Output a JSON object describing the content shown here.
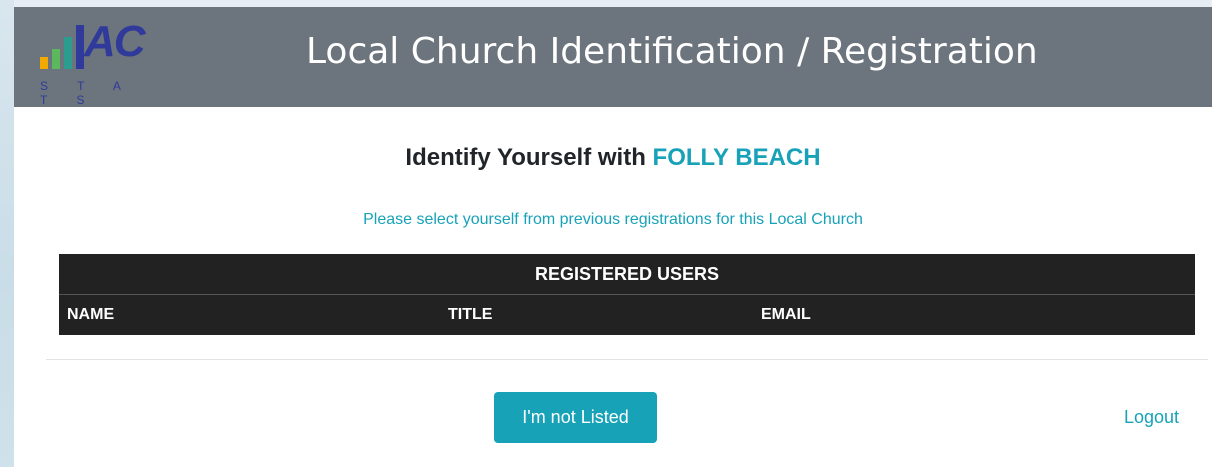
{
  "app": {
    "logo_text": "AC",
    "logo_subtext": "S T A T S",
    "title": "Local Church Identification / Registration"
  },
  "identify": {
    "prefix": "Identify Yourself with",
    "church_name": "FOLLY BEACH",
    "instruction": "Please select yourself from previous registrations for this Local Church"
  },
  "table": {
    "caption": "REGISTERED USERS",
    "columns": [
      "NAME",
      "TITLE",
      "EMAIL"
    ],
    "rows": []
  },
  "actions": {
    "not_listed_label": "I'm not Listed",
    "logout_label": "Logout"
  },
  "colors": {
    "accent": "#17a2b8",
    "header_bg": "#6c757d",
    "table_bg": "#222222"
  }
}
